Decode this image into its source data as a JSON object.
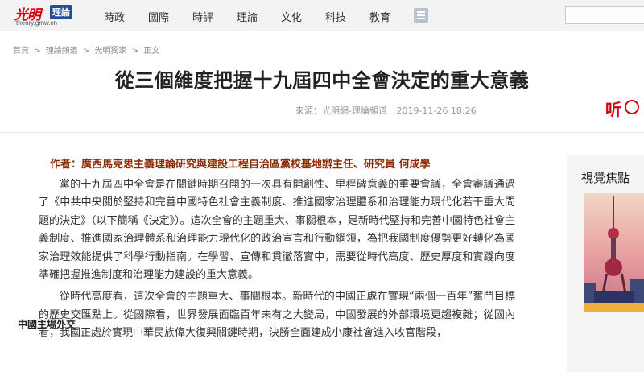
{
  "site": {
    "logo_text": "光明",
    "logo_badge": "理論",
    "logo_url": "theory.gmw.cn"
  },
  "nav": {
    "items": [
      "時政",
      "國際",
      "時評",
      "理論",
      "文化",
      "科技",
      "教育"
    ],
    "menu_icon": "menu-grid-icon"
  },
  "search": {
    "value": ""
  },
  "breadcrumb": {
    "items": [
      "首頁",
      "理論頻道",
      "光明獨家",
      "正文"
    ],
    "separator": ">"
  },
  "article": {
    "title": "從三個維度把握十九屆四中全會決定的重大意義",
    "source": "來源：光明網-理論頻道",
    "date": "2019-11-26 18:26",
    "listen_label": "听",
    "author": "作者：廣西馬克思主義理論研究與建設工程自治區黨校基地辦主任、研究員 何成學",
    "paragraphs": [
      "黨的十九屆四中全會是在關鍵時期召開的一次具有開創性、里程碑意義的重要會議，全會審議通過了《中共中央關於堅持和完善中國特色社會主義制度、推進國家治理體系和治理能力現代化若干重大問題的決定》（以下簡稱《決定》）。這次全會的主題重大、事關根本，是新時代堅持和完善中國特色社會主義制度、推進國家治理體系和治理能力現代化的政治宣言和行動綱領，為把我國制度優勢更好轉化為國家治理效能提供了科學行動指南。在學習、宣傳和貫徹落實中，需要從時代高度、歷史厚度和實踐向度準確把握推進制度和治理能力建設的重大意義。",
      "從時代高度看，這次全會的主題重大、事關根本。新時代的中國正處在實現“兩個一百年”奮鬥目標的歷史交匯點上。從國際看，世界發展面臨百年未有之大變局，中國發展的外部環境更趨複雜；從國內看，我國正處於實現中華民族偉大復興關鍵時期，決勝全面建成小康社會進入收官階段，"
    ]
  },
  "sidebar": {
    "title": "視覺焦點",
    "caption": "中國主場外交"
  },
  "colors": {
    "brand_red": "#d7000f",
    "author_brown": "#8b2a06",
    "nav_bg": "#f3f3f3",
    "logo_blue": "#1f4e9c"
  }
}
